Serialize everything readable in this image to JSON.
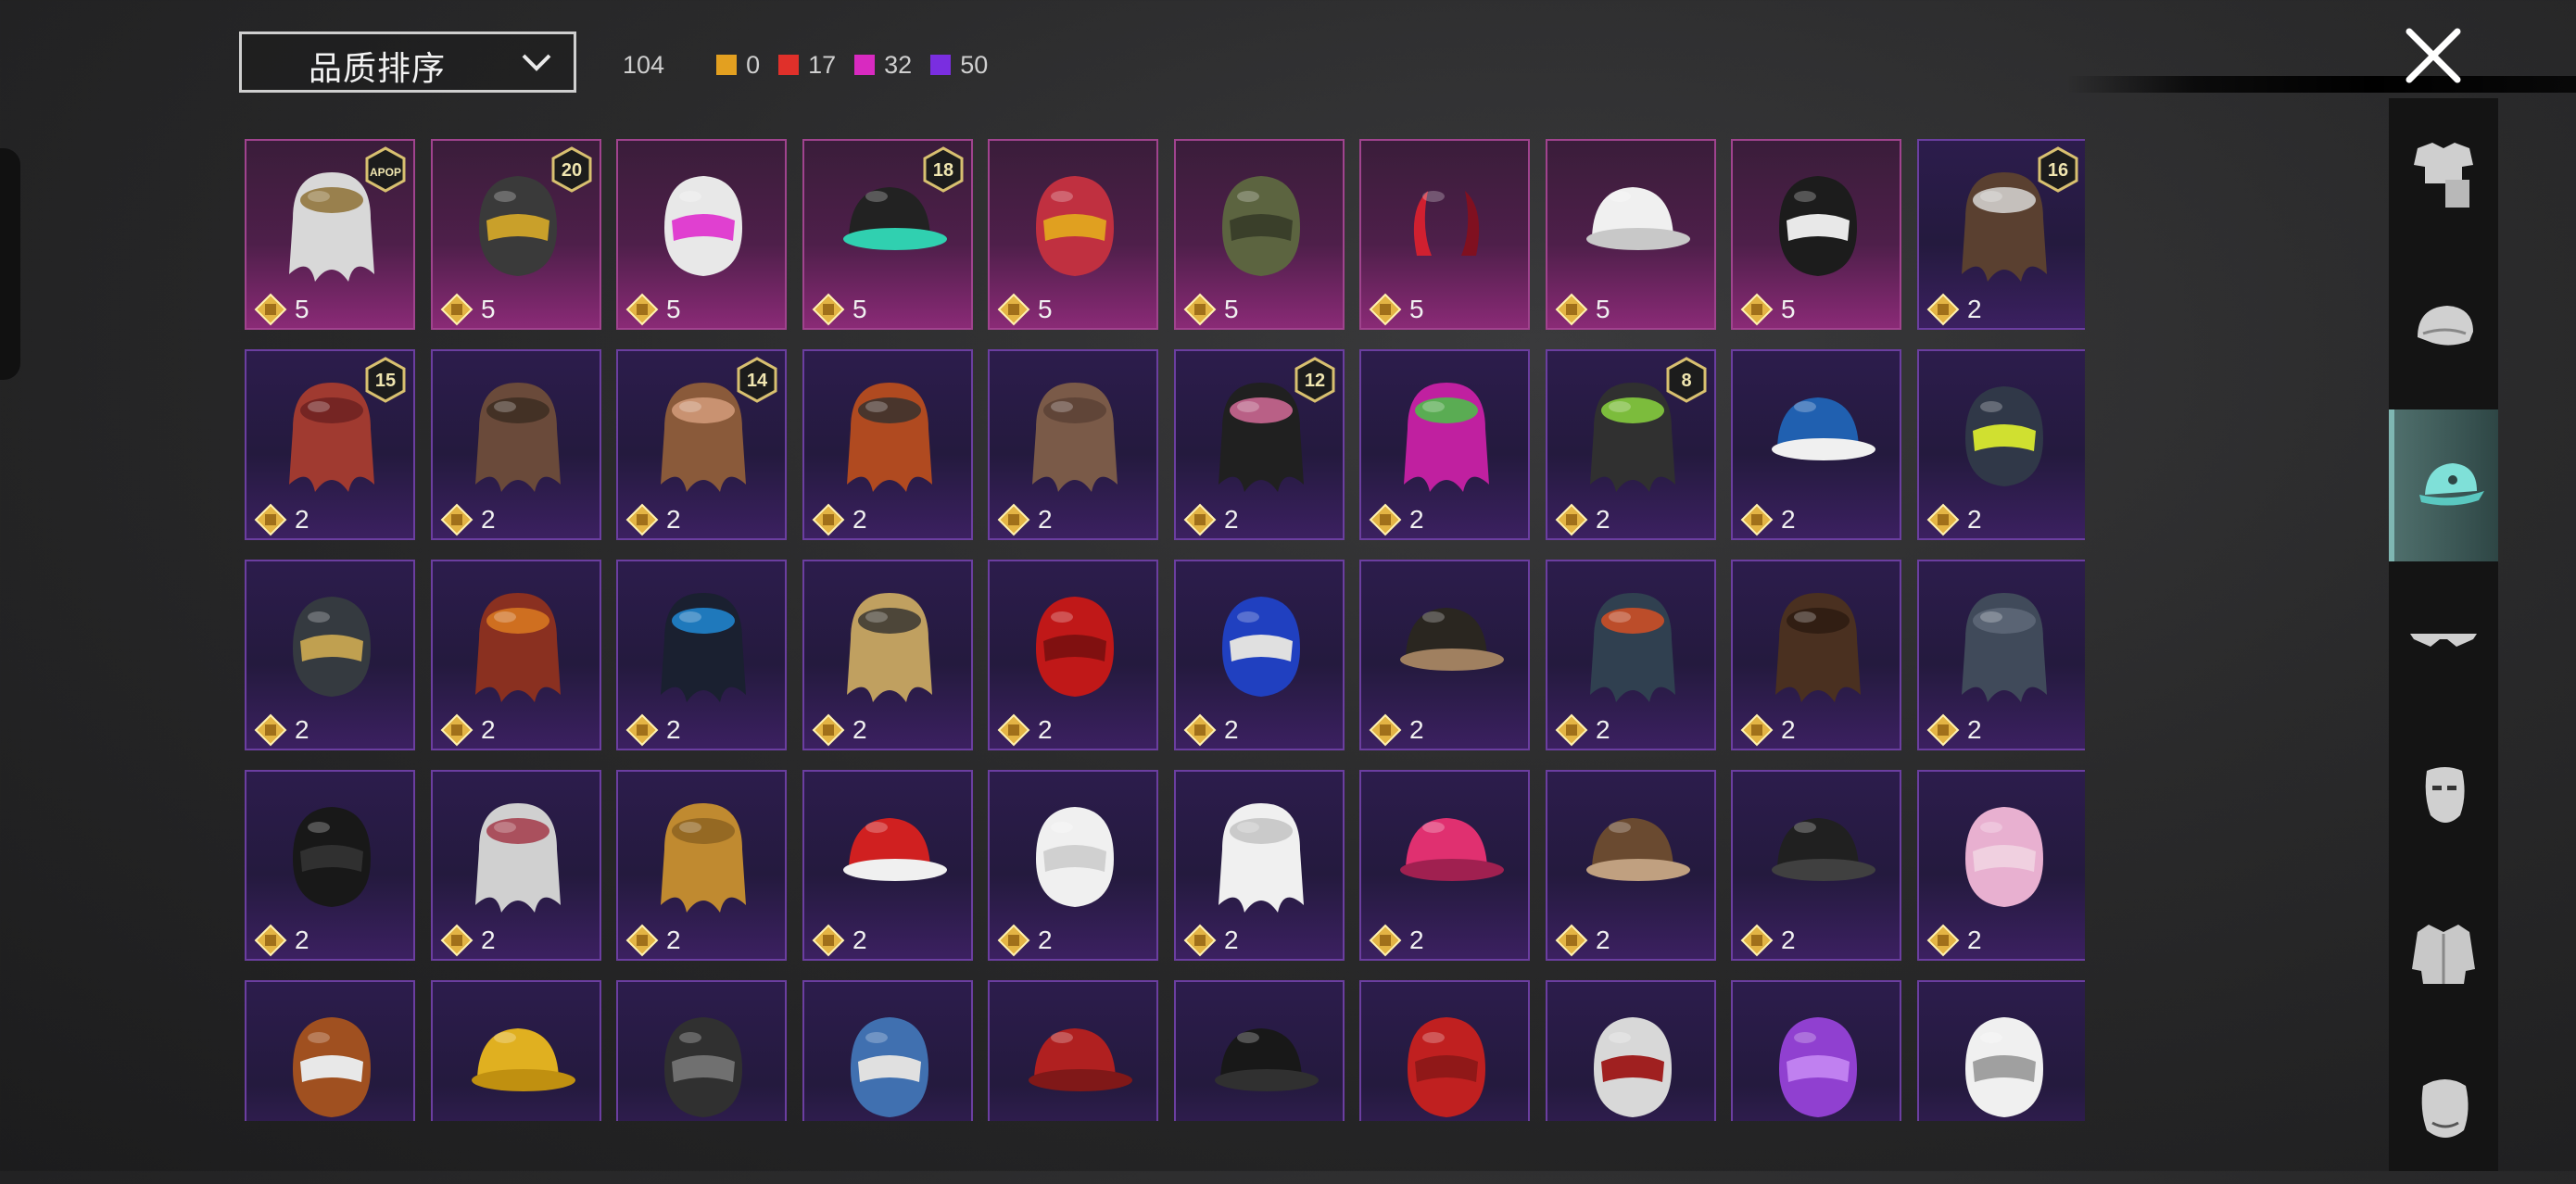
{
  "sort": {
    "label": "品质排序"
  },
  "counts": {
    "total": "104",
    "items": [
      {
        "value": "0",
        "color": "#e3a020"
      },
      {
        "value": "17",
        "color": "#e0302a"
      },
      {
        "value": "32",
        "color": "#d82ac0"
      },
      {
        "value": "50",
        "color": "#7a2ee0"
      }
    ]
  },
  "colors": {
    "purple_border": "#6b3ea0",
    "pink_border": "#a0438e",
    "active_tab": "#4f6f6c",
    "icon_teal": "#7fe0d8"
  },
  "grid": {
    "rows": [
      [
        {
          "qty": "5",
          "tier": "pink",
          "item": "white-hair-crown-icon",
          "badge": "APOP"
        },
        {
          "qty": "5",
          "tier": "pink",
          "item": "gold-black-mask-icon",
          "badge": "20"
        },
        {
          "qty": "5",
          "tier": "pink",
          "item": "pink-visor-hood-icon",
          "badge": ""
        },
        {
          "qty": "5",
          "tier": "pink",
          "item": "headphones-cap-icon",
          "badge": "18"
        },
        {
          "qty": "5",
          "tier": "pink",
          "item": "feather-headdress-icon",
          "badge": ""
        },
        {
          "qty": "5",
          "tier": "pink",
          "item": "military-helmet-icon",
          "badge": ""
        },
        {
          "qty": "5",
          "tier": "pink",
          "item": "devil-horns-icon",
          "badge": ""
        },
        {
          "qty": "5",
          "tier": "pink",
          "item": "white-sun-hat-icon",
          "badge": ""
        },
        {
          "qty": "5",
          "tier": "pink",
          "item": "skull-balaclava-icon",
          "badge": ""
        },
        {
          "qty": "2",
          "tier": "purple",
          "item": "camo-bandana-hair-icon",
          "badge": "16"
        }
      ],
      [
        {
          "qty": "2",
          "tier": "purple",
          "item": "pumpkin-red-hair-icon",
          "badge": "15"
        },
        {
          "qty": "2",
          "tier": "purple",
          "item": "goggles-hair-icon",
          "badge": ""
        },
        {
          "qty": "2",
          "tier": "purple",
          "item": "cat-ear-long-hair-icon",
          "badge": "14"
        },
        {
          "qty": "2",
          "tier": "purple",
          "item": "orange-hair-headset-icon",
          "badge": ""
        },
        {
          "qty": "2",
          "tier": "purple",
          "item": "brown-bob-hair-icon",
          "badge": ""
        },
        {
          "qty": "2",
          "tier": "purple",
          "item": "bunny-ear-helmet-icon",
          "badge": "12"
        },
        {
          "qty": "2",
          "tier": "purple",
          "item": "twisted-horns-icon",
          "badge": ""
        },
        {
          "qty": "2",
          "tier": "purple",
          "item": "green-skull-hair-icon",
          "badge": "8"
        },
        {
          "qty": "2",
          "tier": "purple",
          "item": "baseball-cap-icon",
          "badge": ""
        },
        {
          "qty": "2",
          "tier": "purple",
          "item": "gas-mask-helmet-icon",
          "badge": ""
        }
      ],
      [
        {
          "qty": "2",
          "tier": "purple",
          "item": "gold-visor-helmet-icon",
          "badge": ""
        },
        {
          "qty": "2",
          "tier": "purple",
          "item": "red-hair-goggles-icon",
          "badge": ""
        },
        {
          "qty": "2",
          "tier": "purple",
          "item": "dark-blue-helmet-icon",
          "badge": ""
        },
        {
          "qty": "2",
          "tier": "purple",
          "item": "blonde-wavy-hair-icon",
          "badge": ""
        },
        {
          "qty": "2",
          "tier": "purple",
          "item": "red-mohawk-icon",
          "badge": ""
        },
        {
          "qty": "2",
          "tier": "purple",
          "item": "cricket-helmet-icon",
          "badge": ""
        },
        {
          "qty": "2",
          "tier": "purple",
          "item": "steampunk-hat-icon",
          "badge": ""
        },
        {
          "qty": "2",
          "tier": "purple",
          "item": "ninja-mask-hair-icon",
          "badge": ""
        },
        {
          "qty": "2",
          "tier": "purple",
          "item": "brown-long-hair-icon",
          "badge": ""
        },
        {
          "qty": "2",
          "tier": "purple",
          "item": "grey-cap-icon",
          "badge": ""
        }
      ],
      [
        {
          "qty": "2",
          "tier": "purple",
          "item": "black-gas-mask-icon",
          "badge": ""
        },
        {
          "qty": "2",
          "tier": "purple",
          "item": "ski-goggles-hood-icon",
          "badge": ""
        },
        {
          "qty": "2",
          "tier": "purple",
          "item": "mustard-beanie-icon",
          "badge": ""
        },
        {
          "qty": "2",
          "tier": "purple",
          "item": "mushroom-hat-icon",
          "badge": ""
        },
        {
          "qty": "2",
          "tier": "purple",
          "item": "white-turban-icon",
          "badge": ""
        },
        {
          "qty": "2",
          "tier": "purple",
          "item": "white-wrap-icon",
          "badge": ""
        },
        {
          "qty": "2",
          "tier": "purple",
          "item": "pink-beret-icon",
          "badge": ""
        },
        {
          "qty": "2",
          "tier": "purple",
          "item": "aviator-cap-icon",
          "badge": ""
        },
        {
          "qty": "2",
          "tier": "purple",
          "item": "black-cap-icon",
          "badge": ""
        },
        {
          "qty": "2",
          "tier": "purple",
          "item": "cat-ear-headphones-icon",
          "badge": ""
        }
      ],
      [
        {
          "qty": "",
          "tier": "purple",
          "item": "football-helmet-icon",
          "badge": ""
        },
        {
          "qty": "",
          "tier": "purple",
          "item": "yellow-bucket-hat-icon",
          "badge": ""
        },
        {
          "qty": "",
          "tier": "purple",
          "item": "black-mask-icon",
          "badge": ""
        },
        {
          "qty": "",
          "tier": "purple",
          "item": "shark-hood-icon",
          "badge": ""
        },
        {
          "qty": "",
          "tier": "purple",
          "item": "red-beret-icon",
          "badge": ""
        },
        {
          "qty": "",
          "tier": "purple",
          "item": "black-bowler-hat-icon",
          "badge": ""
        },
        {
          "qty": "",
          "tier": "purple",
          "item": "red-fedora-icon",
          "badge": ""
        },
        {
          "qty": "",
          "tier": "purple",
          "item": "shark-head-icon",
          "badge": ""
        },
        {
          "qty": "",
          "tier": "purple",
          "item": "flower-crown-icon",
          "badge": ""
        },
        {
          "qty": "",
          "tier": "purple",
          "item": "maid-headband-icon",
          "badge": ""
        }
      ]
    ]
  },
  "rail": {
    "items": [
      {
        "icon": "outfit-icon",
        "active": false
      },
      {
        "icon": "head-icon",
        "active": false
      },
      {
        "icon": "hat-icon",
        "active": true
      },
      {
        "icon": "glasses-icon",
        "active": false
      },
      {
        "icon": "mask-icon",
        "active": false
      },
      {
        "icon": "jacket-icon",
        "active": false
      },
      {
        "icon": "face-icon",
        "active": false
      }
    ]
  }
}
